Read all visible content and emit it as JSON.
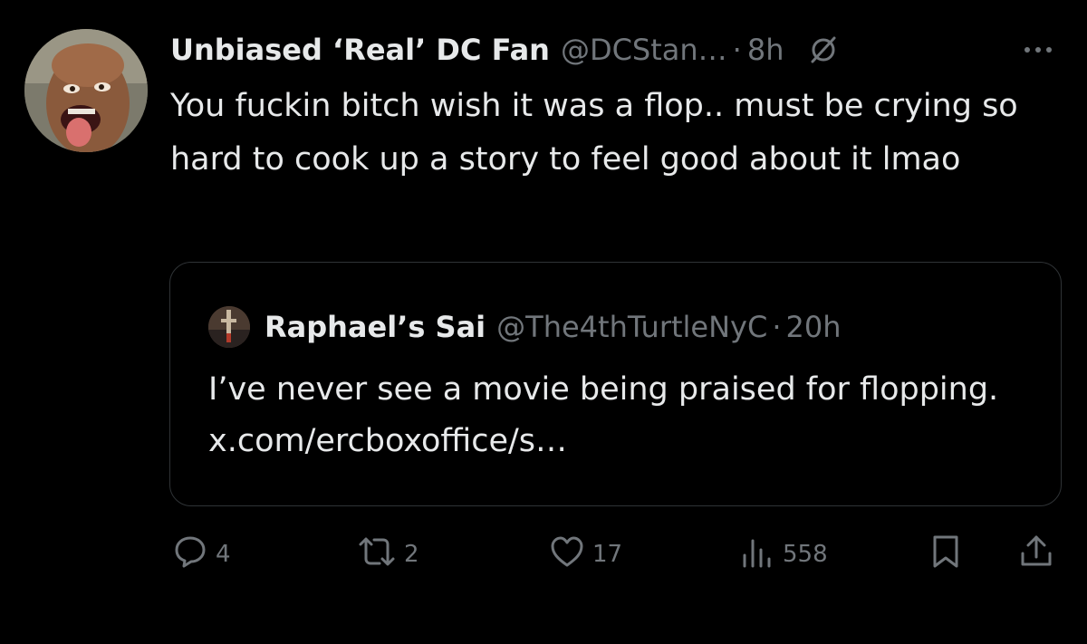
{
  "tweet": {
    "display_name": "Unbiased ‘Real’ DC Fan",
    "handle": "@DCStan…",
    "separator": "·",
    "time": "8h",
    "avatar_icon": "profile-photo",
    "text": "You fuckin bitch wish it was a flop.. must be crying so hard to cook up a story to feel good about it lmao"
  },
  "quoted_tweet": {
    "display_name": "Raphael’s Sai",
    "handle": "@The4thTurtleNyC",
    "separator": "·",
    "time": "20h",
    "avatar_icon": "profile-photo",
    "text": "I’ve never see a movie being praised for flopping. x.com/ercboxoffice/s…"
  },
  "actions": {
    "replies": "4",
    "reposts": "2",
    "likes": "17",
    "views": "558"
  },
  "icons": {
    "header": [
      "grok-icon",
      "more-icon"
    ],
    "actions": [
      "reply-icon",
      "repost-icon",
      "like-icon",
      "views-icon",
      "bookmark-icon",
      "share-icon"
    ]
  },
  "colors": {
    "background": "#000000",
    "primary_text": "#e7e9ea",
    "secondary_text": "#71767b",
    "border": "#2f3336"
  }
}
